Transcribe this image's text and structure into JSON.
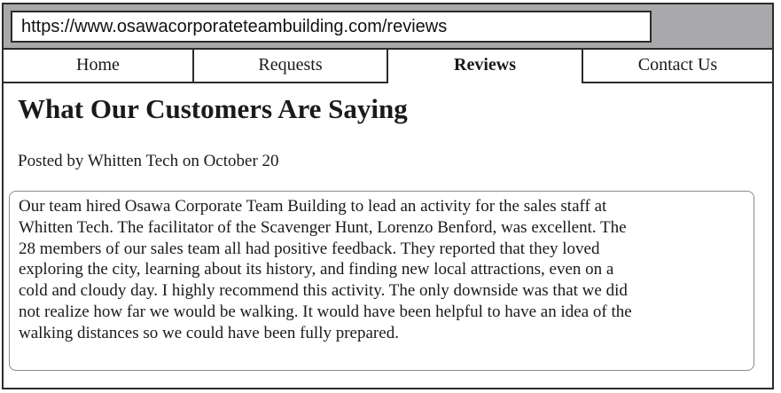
{
  "browser": {
    "url": "https://www.osawacorporateteambuilding.com/reviews"
  },
  "nav": {
    "tabs": [
      {
        "label": "Home"
      },
      {
        "label": "Requests"
      },
      {
        "label": "Reviews"
      },
      {
        "label": "Contact Us"
      }
    ],
    "active_tab": "Reviews"
  },
  "main": {
    "title": "What Our Customers Are Saying",
    "byline": "Posted by Whitten Tech on October 20",
    "review_lines": [
      "Our team hired Osawa Corporate Team Building to lead an activity for the sales staff at",
      "Whitten Tech. The facilitator of the Scavenger Hunt, Lorenzo Benford, was excellent. The",
      "28 members of our sales team all had positive feedback. They reported that they loved",
      "exploring the city, learning about its history, and finding new local attractions, even on a",
      "cold and cloudy day. I highly recommend this activity. The only downside was that we did",
      "not realize how far we would be walking. It would have been helpful to have an idea of the",
      "walking distances so we could have been fully prepared."
    ]
  },
  "colors": {
    "chrome_bar": "#a9a9ab",
    "border": "#2b2b2b",
    "review_border": "#8a8a8a",
    "text": "#1a1a1a"
  }
}
